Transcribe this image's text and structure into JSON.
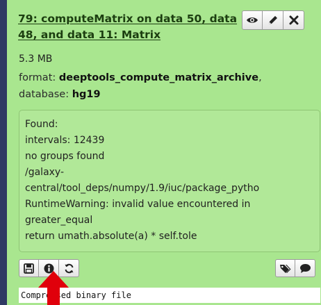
{
  "dataset": {
    "title": "79: computeMatrix on data 50, data 48, and data 11: Matrix",
    "size": "5.3 MB",
    "format_label": "format:",
    "format_value": "deeptools_compute_matrix_archive",
    "database_label": "database:",
    "database_value": "hg19",
    "title_buttons": [
      {
        "name": "view-button",
        "icon": "eye-icon"
      },
      {
        "name": "edit-button",
        "icon": "pencil-icon"
      },
      {
        "name": "delete-button",
        "icon": "close-icon"
      }
    ],
    "peek_lines": [
      "Found:",
      "intervals: 12439",
      "no groups found",
      "/galaxy-",
      "central/tool_deps/numpy/1.9/iuc/package_pytho",
      "RuntimeWarning: invalid value encountered in",
      "greater_equal",
      "return umath.absolute(a) * self.tole"
    ],
    "left_actions": [
      {
        "name": "download-button",
        "icon": "save-icon"
      },
      {
        "name": "info-button",
        "icon": "info-icon"
      },
      {
        "name": "rerun-button",
        "icon": "refresh-icon"
      }
    ],
    "right_actions": [
      {
        "name": "tags-button",
        "icon": "tags-icon"
      },
      {
        "name": "annotation-button",
        "icon": "comment-icon"
      }
    ],
    "mime_text": "Compressed binary file",
    "annotation_arrow_color": "#e0000b",
    "colors": {
      "panel_bg": "#a9e68f",
      "left_bar": "#2f3a63",
      "title": "#1c3e10"
    }
  }
}
